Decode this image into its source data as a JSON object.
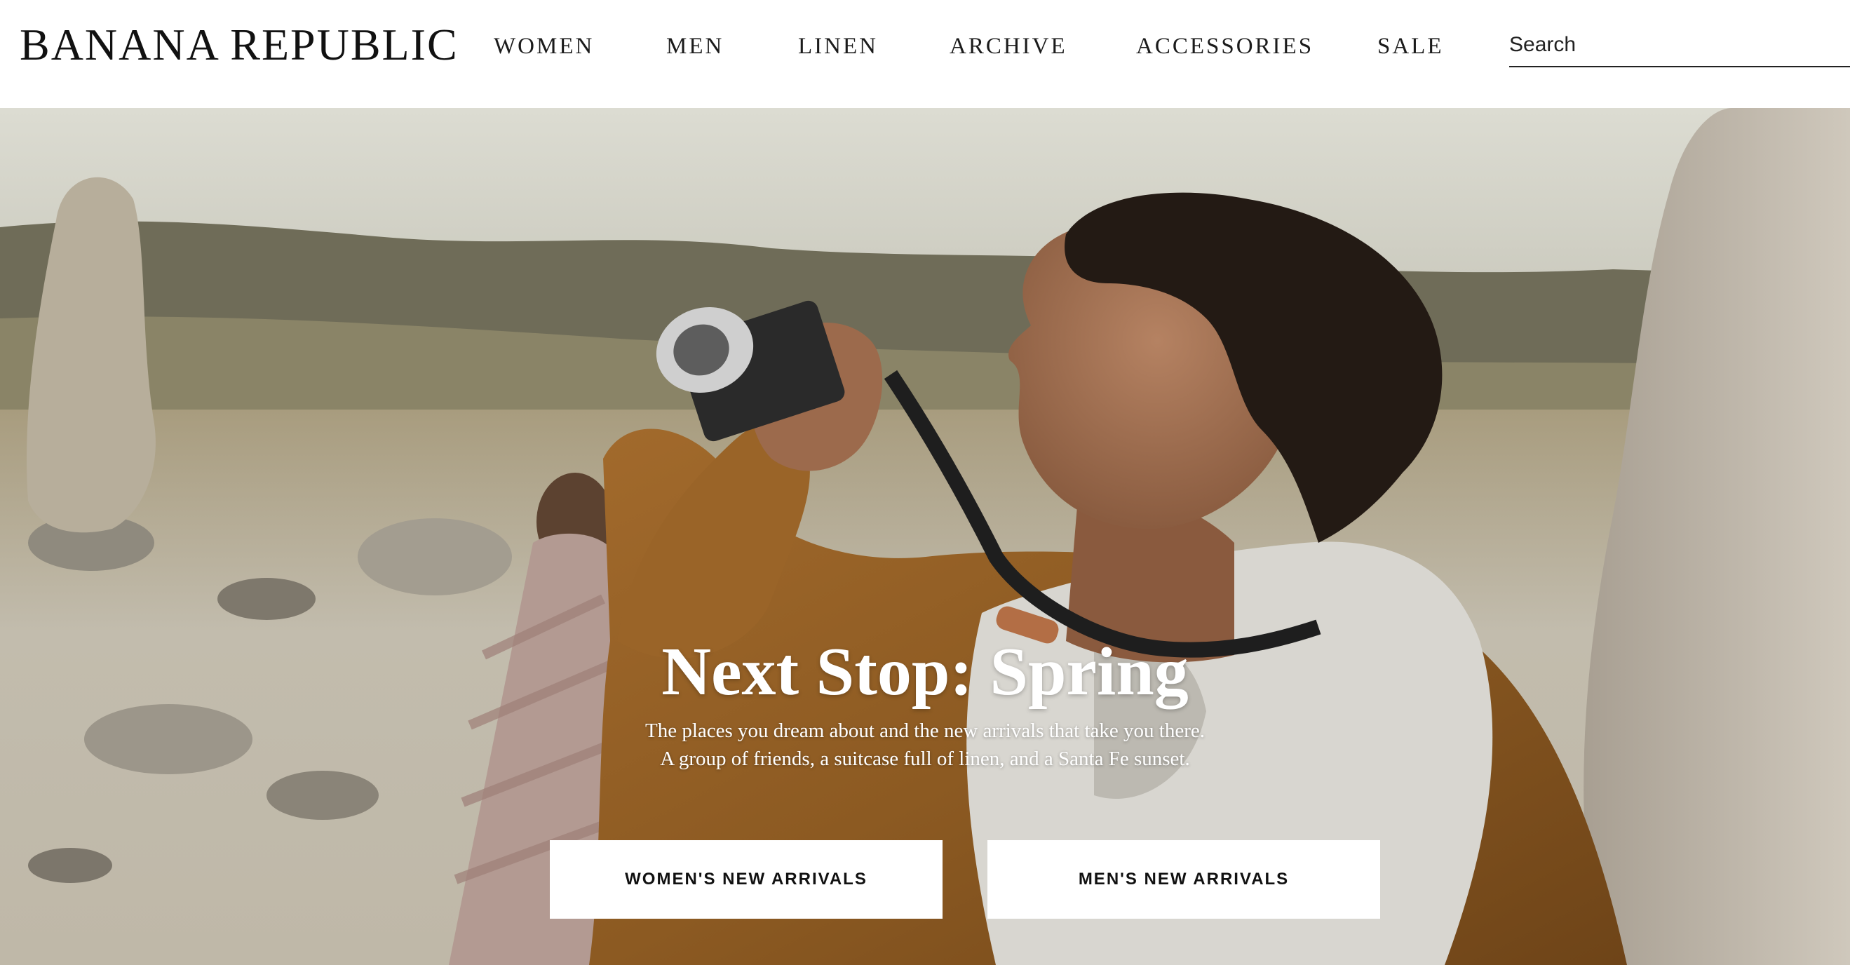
{
  "brand": {
    "logo_text": "BANANA REPUBLIC"
  },
  "nav": {
    "items": [
      {
        "label": "WOMEN"
      },
      {
        "label": "MEN"
      },
      {
        "label": "LINEN"
      },
      {
        "label": "ARCHIVE"
      },
      {
        "label": "ACCESSORIES"
      },
      {
        "label": "SALE"
      }
    ]
  },
  "search": {
    "placeholder": "Search",
    "value": ""
  },
  "hero": {
    "title": "Next Stop: Spring",
    "subtitle_line1": "The places you dream about and the new arrivals that take you there.",
    "subtitle_line2": "A group of friends, a suitcase full of linen, and a Santa Fe sunset.",
    "image_alt": "Man in a tan suede jacket and grey hoodie holding a camera in a desert landscape, woman in a striped dress in the background"
  },
  "cta": {
    "women_label": "WOMEN'S NEW ARRIVALS",
    "men_label": "MEN'S NEW ARRIVALS"
  },
  "colors": {
    "header_bg": "#ffffff",
    "text_primary": "#111111",
    "hero_text": "#ffffff",
    "button_bg": "#ffffff"
  }
}
